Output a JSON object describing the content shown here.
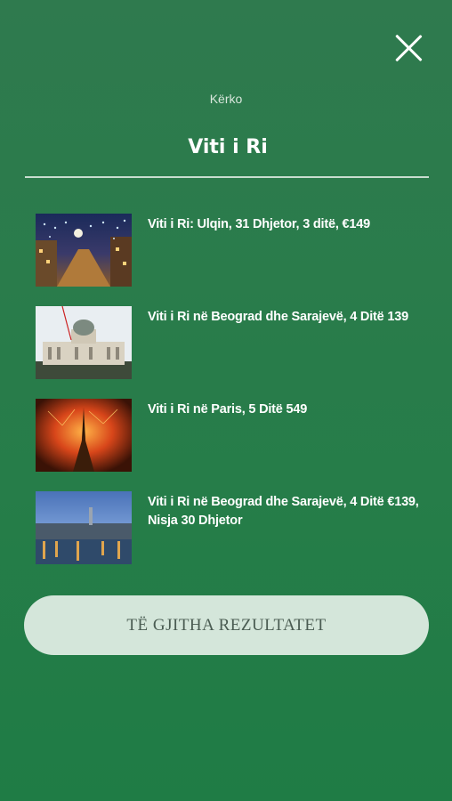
{
  "search": {
    "label": "Kërko",
    "query": "Viti i Ri"
  },
  "results": [
    {
      "title": "Viti i Ri: Ulqin, 31 Dhjetor, 3 ditë, €149",
      "icon": "street-night-lights-photo"
    },
    {
      "title": "Viti i Ri në Beograd dhe Sarajevë, 4 Ditë 139",
      "icon": "parliament-building-photo"
    },
    {
      "title": "Viti i Ri në Paris, 5 Ditë 549",
      "icon": "eiffel-fireworks-photo"
    },
    {
      "title": "Viti i Ri në Beograd dhe Sarajevë, 4 Ditë €139, Nisja 30 Dhjetor",
      "icon": "river-city-dusk-photo"
    }
  ],
  "all_results_label": "TË GJITHA REZULTATET",
  "colors": {
    "background": "#2e7a4c",
    "button": "#d4e6da",
    "text": "#ffffff"
  }
}
